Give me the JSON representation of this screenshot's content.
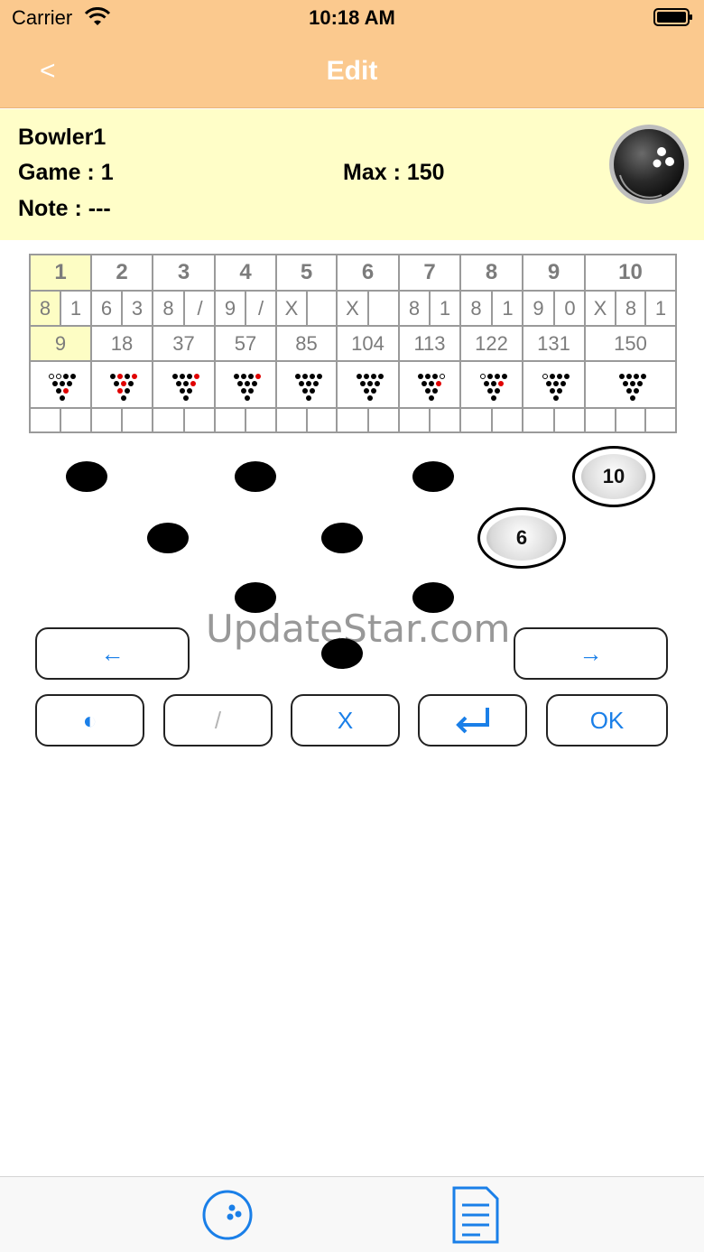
{
  "status_bar": {
    "carrier": "Carrier",
    "time": "10:18 AM"
  },
  "nav": {
    "back_label": "<",
    "title": "Edit"
  },
  "info": {
    "bowler": "Bowler1",
    "game": "Game : 1",
    "max": "Max : 150",
    "note": "Note : ---",
    "ball_icon": "bowling-ball-icon"
  },
  "frames": [
    {
      "number": "1",
      "rolls": [
        "8",
        "1"
      ],
      "total": "9",
      "pins": [
        0,
        0,
        1,
        1,
        1,
        1,
        1,
        1,
        2,
        1
      ]
    },
    {
      "number": "2",
      "rolls": [
        "6",
        "3"
      ],
      "total": "18",
      "pins": [
        1,
        2,
        1,
        2,
        1,
        2,
        1,
        2,
        1,
        1
      ]
    },
    {
      "number": "3",
      "rolls": [
        "8",
        "/"
      ],
      "total": "37",
      "pins": [
        1,
        1,
        1,
        2,
        1,
        1,
        2,
        1,
        1,
        1
      ]
    },
    {
      "number": "4",
      "rolls": [
        "9",
        "/"
      ],
      "total": "57",
      "pins": [
        1,
        1,
        1,
        2,
        1,
        1,
        1,
        1,
        1,
        1
      ]
    },
    {
      "number": "5",
      "rolls": [
        "X",
        ""
      ],
      "total": "85",
      "pins": [
        1,
        1,
        1,
        1,
        1,
        1,
        1,
        1,
        1,
        1
      ]
    },
    {
      "number": "6",
      "rolls": [
        "X",
        ""
      ],
      "total": "104",
      "pins": [
        1,
        1,
        1,
        1,
        1,
        1,
        1,
        1,
        1,
        1
      ]
    },
    {
      "number": "7",
      "rolls": [
        "8",
        "1"
      ],
      "total": "113",
      "pins": [
        1,
        1,
        1,
        0,
        1,
        1,
        2,
        1,
        1,
        1
      ]
    },
    {
      "number": "8",
      "rolls": [
        "8",
        "1"
      ],
      "total": "122",
      "pins": [
        0,
        1,
        1,
        1,
        1,
        1,
        2,
        1,
        1,
        1
      ]
    },
    {
      "number": "9",
      "rolls": [
        "9",
        "0"
      ],
      "total": "131",
      "pins": [
        0,
        1,
        1,
        1,
        1,
        1,
        1,
        1,
        1,
        1
      ]
    },
    {
      "number": "10",
      "rolls": [
        "X",
        "8",
        "1"
      ],
      "total": "150",
      "pins": [
        1,
        1,
        1,
        1,
        1,
        1,
        1,
        1,
        1,
        1
      ]
    }
  ],
  "pin_deck": {
    "standing": [
      {
        "label": "10"
      },
      {
        "label": "6"
      }
    ]
  },
  "watermark": "UpdateStar.com",
  "buttons": {
    "prev": "←",
    "next": "→",
    "half": "◐",
    "spare": "/",
    "strike": "X",
    "enter": "↵",
    "ok": "OK"
  },
  "colors": {
    "header_bg": "#fbc98e",
    "info_bg": "#fffec8",
    "accent": "#1a7fe8",
    "down_pin": "#e00000"
  },
  "tabs": [
    {
      "name": "bowling-ball-tab-icon"
    },
    {
      "name": "document-tab-icon"
    }
  ]
}
